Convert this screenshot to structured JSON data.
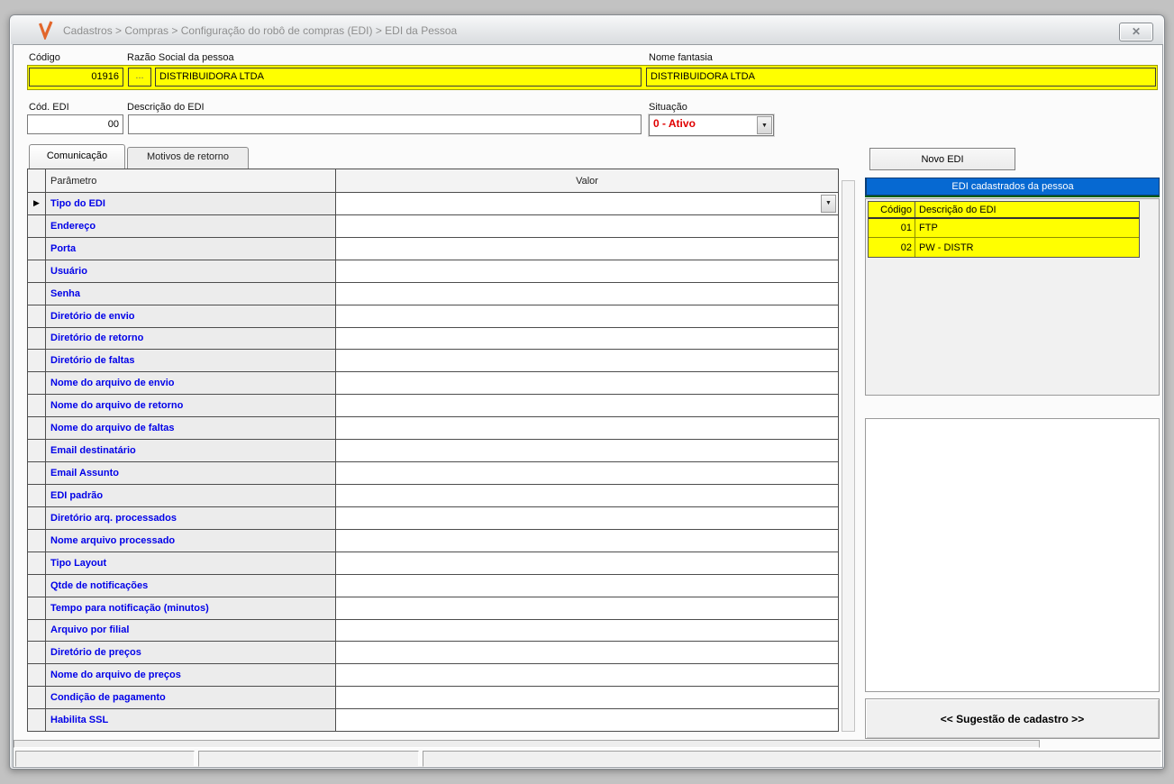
{
  "titlebar": {
    "title": "Cadastros > Compras > Configuração do robô de compras (EDI) > EDI da Pessoa"
  },
  "icons": {
    "logo": "V-checkmark",
    "close": "✕",
    "dropdown": "▼",
    "row_indicator": "▶"
  },
  "form": {
    "codigo_label": "Código",
    "codigo_value": "01916",
    "lookup_button": "...",
    "razao_label": "Razão Social da pessoa",
    "razao_value": "DISTRIBUIDORA LTDA",
    "fantasia_label": "Nome fantasia",
    "fantasia_value": "DISTRIBUIDORA LTDA",
    "cod_edi_label": "Cód. EDI",
    "cod_edi_value": "00",
    "descricao_label": "Descrição do EDI",
    "descricao_value": "",
    "situacao_label": "Situação",
    "situacao_value": "0 - Ativo"
  },
  "tabs": [
    {
      "label": "Comunicação",
      "active": true
    },
    {
      "label": "Motivos de retorno",
      "active": false
    }
  ],
  "param_grid": {
    "col_param": "Parâmetro",
    "col_valor": "Valor",
    "rows": [
      "Tipo do EDI",
      "Endereço",
      "Porta",
      "Usuário",
      "Senha",
      "Diretório de envio",
      "Diretório de retorno",
      "Diretório de faltas",
      "Nome do arquivo de envio",
      "Nome do arquivo de retorno",
      "Nome do arquivo de faltas",
      "Email destinatário",
      "Email Assunto",
      "EDI padrão",
      "Diretório arq. processados",
      "Nome arquivo processado",
      "Tipo Layout",
      "Qtde de notificações",
      "Tempo para notificação (minutos)",
      "Arquivo por filial",
      "Diretório de preços",
      "Nome do arquivo de preços",
      "Condição de pagamento",
      "Habilita SSL"
    ],
    "values": [
      "",
      "",
      "",
      "",
      "",
      "",
      "",
      "",
      "",
      "",
      "",
      "",
      "",
      "",
      "",
      "",
      "",
      "",
      "",
      "",
      "",
      "",
      "",
      ""
    ]
  },
  "right_panel": {
    "novo_edi": "Novo EDI",
    "list_title": "EDI cadastrados da pessoa",
    "grid": {
      "col_codigo": "Código",
      "col_descricao": "Descrição do EDI",
      "rows": [
        {
          "codigo": "01",
          "descricao": "FTP"
        },
        {
          "codigo": "02",
          "descricao": "PW - DISTR"
        }
      ]
    },
    "sugestao": "<< Sugestão de cadastro >>"
  },
  "colors": {
    "field_highlight": "#FFFF00",
    "list_header_blue": "#0669D2",
    "list_header_underline": "#0B5E0B",
    "param_text": "#0000E8",
    "situacao_text": "#E00000",
    "logo_orange": "#E2662B"
  }
}
